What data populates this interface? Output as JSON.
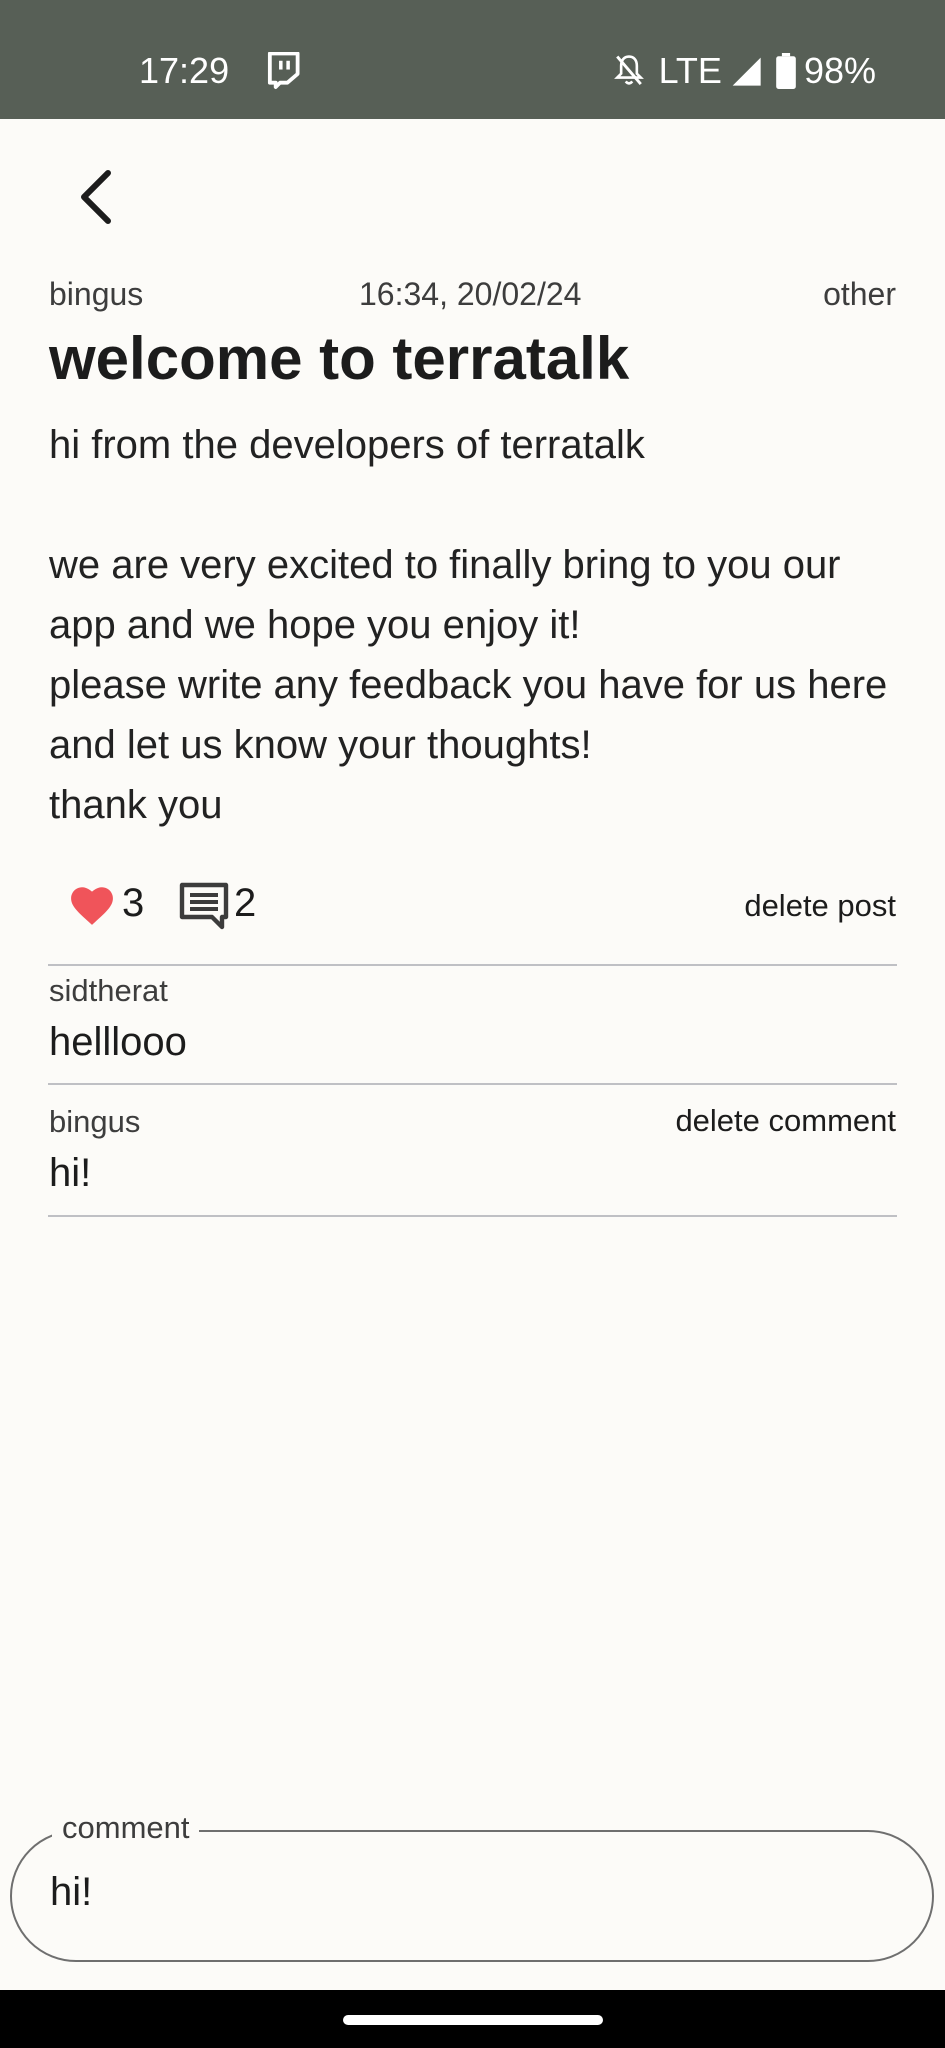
{
  "status_bar": {
    "time": "17:29",
    "network": "LTE",
    "battery": "98%",
    "icons": [
      "twitch-icon",
      "notifications-off-icon",
      "signal-icon",
      "battery-icon"
    ]
  },
  "nav": {
    "back_icon": "back-arrow-icon"
  },
  "post": {
    "author": "bingus",
    "timestamp": "16:34, 20/02/24",
    "category": "other",
    "title": "welcome to terratalk",
    "body": "hi from the developers of terratalk\n\nwe are very excited to finally bring to you our app and we hope you enjoy it!\nplease write any feedback you have for us here and let us know your thoughts!\nthank you",
    "like_count": "3",
    "comment_count": "2",
    "delete_label": "delete post"
  },
  "comments": [
    {
      "author": "sidtherat",
      "text": "helllooo"
    },
    {
      "author": "bingus",
      "text": "hi!",
      "delete_label": "delete comment"
    }
  ],
  "composer": {
    "label": "comment",
    "value": "hi!"
  },
  "colors": {
    "status_bar": "#575f56",
    "background": "#fcfbf8",
    "heart": "#f0545a",
    "divider": "#bfc0c4"
  }
}
